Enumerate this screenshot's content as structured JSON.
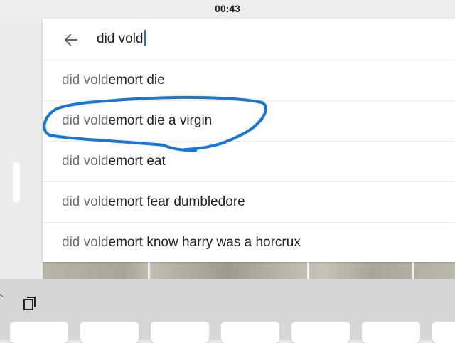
{
  "status_bar": {
    "time": "00:43"
  },
  "search": {
    "query": "did vold"
  },
  "suggestions": [
    {
      "typed": "did vold",
      "completion": "emort die"
    },
    {
      "typed": "did vold",
      "completion": "emort die a virgin"
    },
    {
      "typed": "did vold",
      "completion": "emort eat"
    },
    {
      "typed": "did vold",
      "completion": "emort fear dumbledore"
    },
    {
      "typed": "did vold",
      "completion": "emort know harry was a horcrux"
    }
  ],
  "colors": {
    "annotation": "#1677d6",
    "caret": "#1a73e8"
  },
  "icons": {
    "back": "arrow-left-icon",
    "clipboard": "clipboard-icon"
  }
}
